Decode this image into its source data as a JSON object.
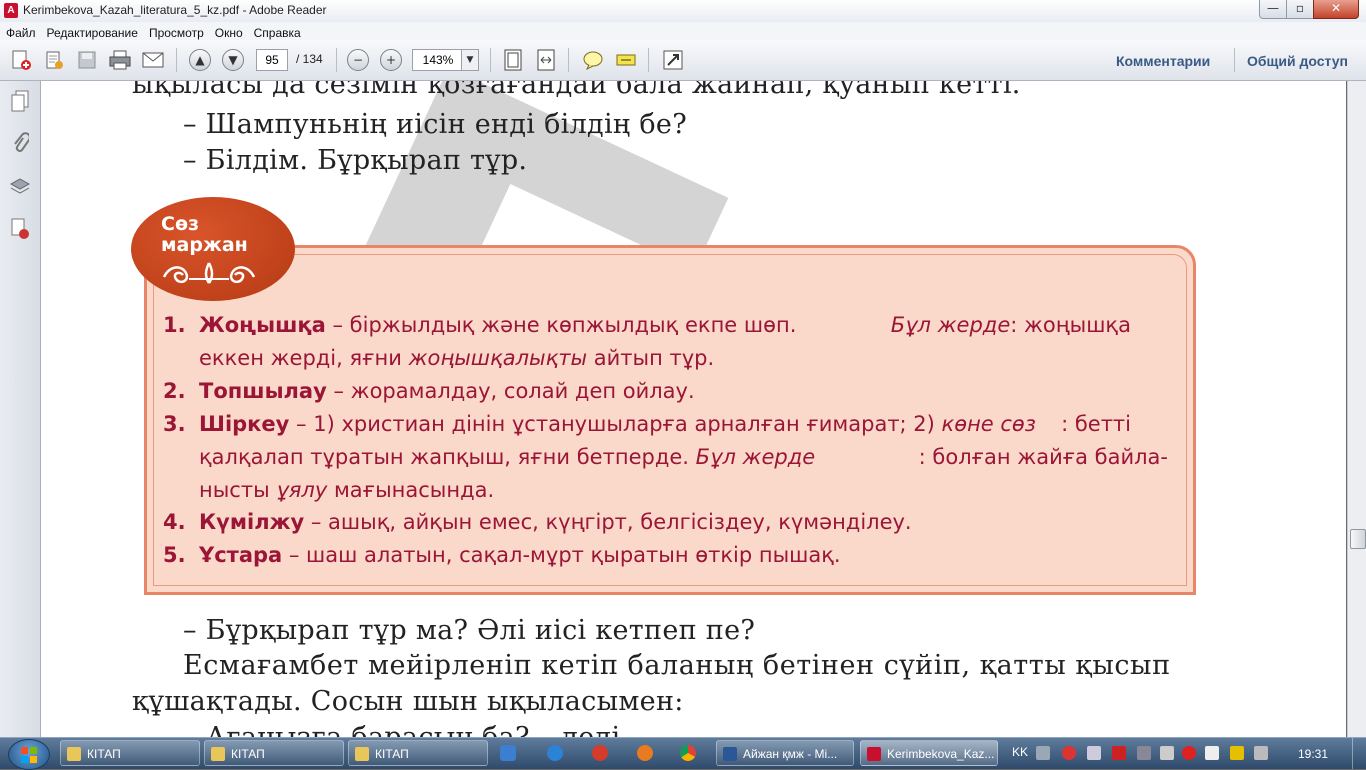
{
  "window": {
    "title": "Kerimbekova_Kazah_literatura_5_kz.pdf - Adobe Reader",
    "app_icon": "pdf-icon",
    "minimize": "—",
    "maximize": "▫",
    "close": "✕"
  },
  "menu": [
    "Файл",
    "Редактирование",
    "Просмотр",
    "Окно",
    "Справка"
  ],
  "toolbar": {
    "page_current": "95",
    "page_total": "/ 134",
    "zoom": "143%",
    "comments_link": "Комментарии",
    "share_link": "Общий доступ"
  },
  "document": {
    "top_lines": [
      "ықыласы да сезімін қозғағандай бала жайнап, қуанып кетті.",
      "– Шампуньнің иісін енді білдің бе?",
      "– Білдім. Бұрқырап тұр."
    ],
    "badge": {
      "line1": "Сөз",
      "line2": "маржан"
    },
    "glossary": [
      {
        "num": "1.",
        "term": "Жоңышқа",
        "line1_parts": [
          "– біржылдық және көпжылдық екпе шөп.",
          "Бұл жерде",
          ": жоңышқа"
        ],
        "line2_parts": [
          "еккен жерді, яғни ",
          "жоңышқалықты",
          " айтып тұр."
        ]
      },
      {
        "num": "2.",
        "term": "Топшылау",
        "text": " – жорамалдау, солай деп ойлау."
      },
      {
        "num": "3.",
        "term": "Шіркеу",
        "line1_parts": [
          "– 1) христиан дінін ұстанушыларға арналған ғимарат; 2) ",
          "көне сөз",
          ": бетті"
        ],
        "line2_parts": [
          "қалқалап тұратын жапқыш, яғни бетперде. ",
          "Бұл жерде",
          ": болған жайға байла-"
        ],
        "line3_parts": [
          "нысты ",
          "ұялу",
          " мағынасында."
        ]
      },
      {
        "num": "4.",
        "term": "Күмілжу",
        "text": " – ашық, айқын емес, күңгірт, белгісіздеу, күмәнділеу."
      },
      {
        "num": "5.",
        "term": "Ұстара",
        "text": " – шаш алатын, сақал-мұрт қыратын өткір пышақ."
      }
    ],
    "bottom_lines": [
      "– Бұрқырап тұр ма? Әлі иісі кетпеп пе?",
      "Есмағамбет мейірленіп кетіп баланың бетінен сүйіп, қатты қысып",
      "құшақтады. Сосын шын ықыласымен:",
      "– Ағаңызға барасың ба? – деді."
    ],
    "watermark": "Б"
  },
  "taskbar": {
    "tasks": [
      {
        "label": "КІТАП",
        "icon": "folder-icon"
      },
      {
        "label": "КІТАП",
        "icon": "folder-icon"
      },
      {
        "label": "КІТАП",
        "icon": "folder-icon"
      },
      {
        "label": "Айжан қмж - Mi...",
        "icon": "word-icon"
      },
      {
        "label": "Kerimbekova_Kaz...",
        "icon": "pdf-icon"
      }
    ],
    "lang": "KK",
    "clock": "19:31"
  }
}
